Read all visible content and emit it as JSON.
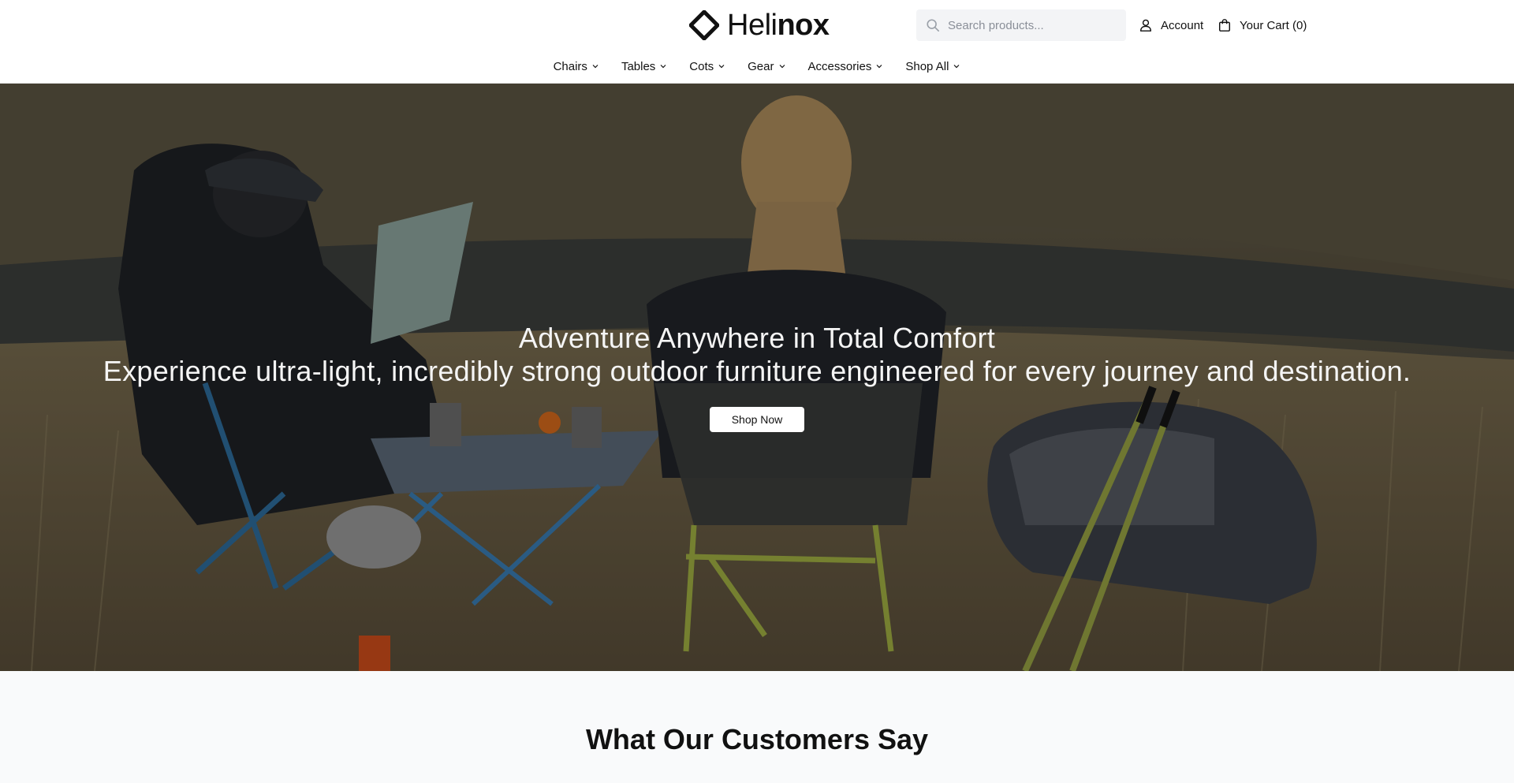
{
  "brand": {
    "name_light": "Heli",
    "name_bold": "nox",
    "logo_icon": "diamond-logo-icon"
  },
  "header": {
    "search": {
      "placeholder": "Search products...",
      "icon": "search-icon"
    },
    "account": {
      "label": "Account",
      "icon": "user-icon"
    },
    "cart": {
      "label": "Your Cart (0)",
      "icon": "shopping-bag-icon"
    }
  },
  "nav": {
    "items": [
      {
        "label": "Chairs",
        "icon": "chevron-down-icon"
      },
      {
        "label": "Tables",
        "icon": "chevron-down-icon"
      },
      {
        "label": "Cots",
        "icon": "chevron-down-icon"
      },
      {
        "label": "Gear",
        "icon": "chevron-down-icon"
      },
      {
        "label": "Accessories",
        "icon": "chevron-down-icon"
      },
      {
        "label": "Shop All",
        "icon": "chevron-down-icon"
      }
    ]
  },
  "hero": {
    "title": "Adventure Anywhere in Total Comfort",
    "subtitle": "Experience ultra-light, incredibly strong outdoor furniture engineered for every journey and destination.",
    "cta_label": "Shop Now"
  },
  "testimonials": {
    "title": "What Our Customers Say"
  },
  "colors": {
    "accent": "#111111",
    "search_bg": "#f3f4f6",
    "section_bg": "#f9fafb"
  }
}
